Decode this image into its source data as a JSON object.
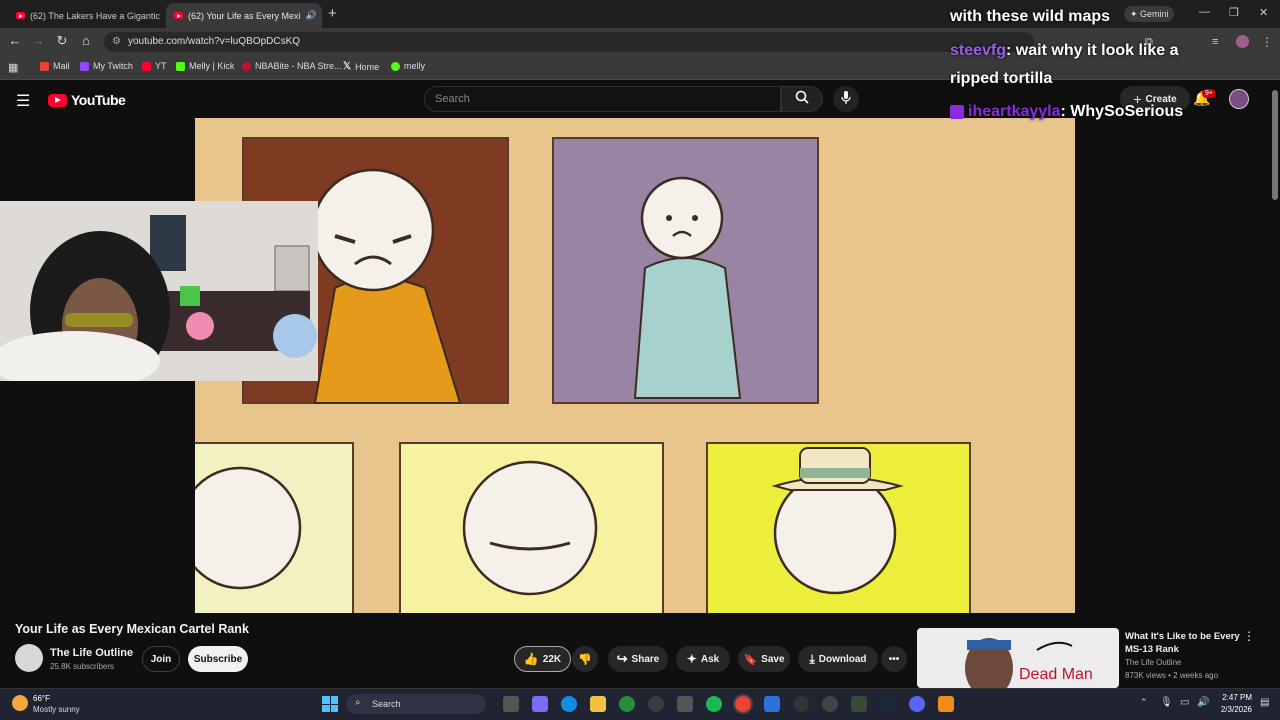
{
  "browser": {
    "tabs": [
      {
        "label": "(62) The Lakers Have a Gigantic",
        "close": "✕"
      },
      {
        "label": "(62) Your Life as Every Mexi",
        "close": "✕"
      }
    ],
    "new_tab": "+",
    "url": "youtube.com/watch?v=luQBOpDCsKQ",
    "gemini_label": "Gemini",
    "bookmarks": [
      "Mail",
      "My Twitch",
      "YT",
      "Melly | Kick",
      "NBABite - NBA Stre...",
      "Home",
      "melly"
    ]
  },
  "youtube": {
    "logo_text": "YouTube",
    "search_placeholder": "Search",
    "create_label": "Create",
    "notif_badge": "9+",
    "video_title": "Your Life as Every Mexican Cartel Rank",
    "channel": {
      "name": "The Life Outline",
      "subs": "25.8K subscribers",
      "join": "Join",
      "subscribe": "Subscribe"
    },
    "actions": {
      "likes": "22K",
      "share": "Share",
      "ask": "Ask",
      "save": "Save",
      "download": "Download"
    },
    "recommended": {
      "title_line1": "What It's Like to be Every",
      "title_line2": "MS-13 Rank",
      "channel": "The Life Outline",
      "meta": "873K views • 2 weeks ago",
      "thumb_text": "Dead Man"
    }
  },
  "chat": [
    {
      "user": "",
      "message": "with these wild maps"
    },
    {
      "user": "steevfg",
      "message": ": wait why it look like a",
      "cont": "ripped tortilla",
      "color": "#9b5de5"
    },
    {
      "user": "iheartkayyla",
      "message": ": WhySoSerious",
      "color": "#8a2be2"
    }
  ],
  "taskbar": {
    "weather_temp": "66°F",
    "weather_desc": "Mostly sunny",
    "search": "Search",
    "time": "2:47 PM",
    "date": "2/3/2026"
  }
}
